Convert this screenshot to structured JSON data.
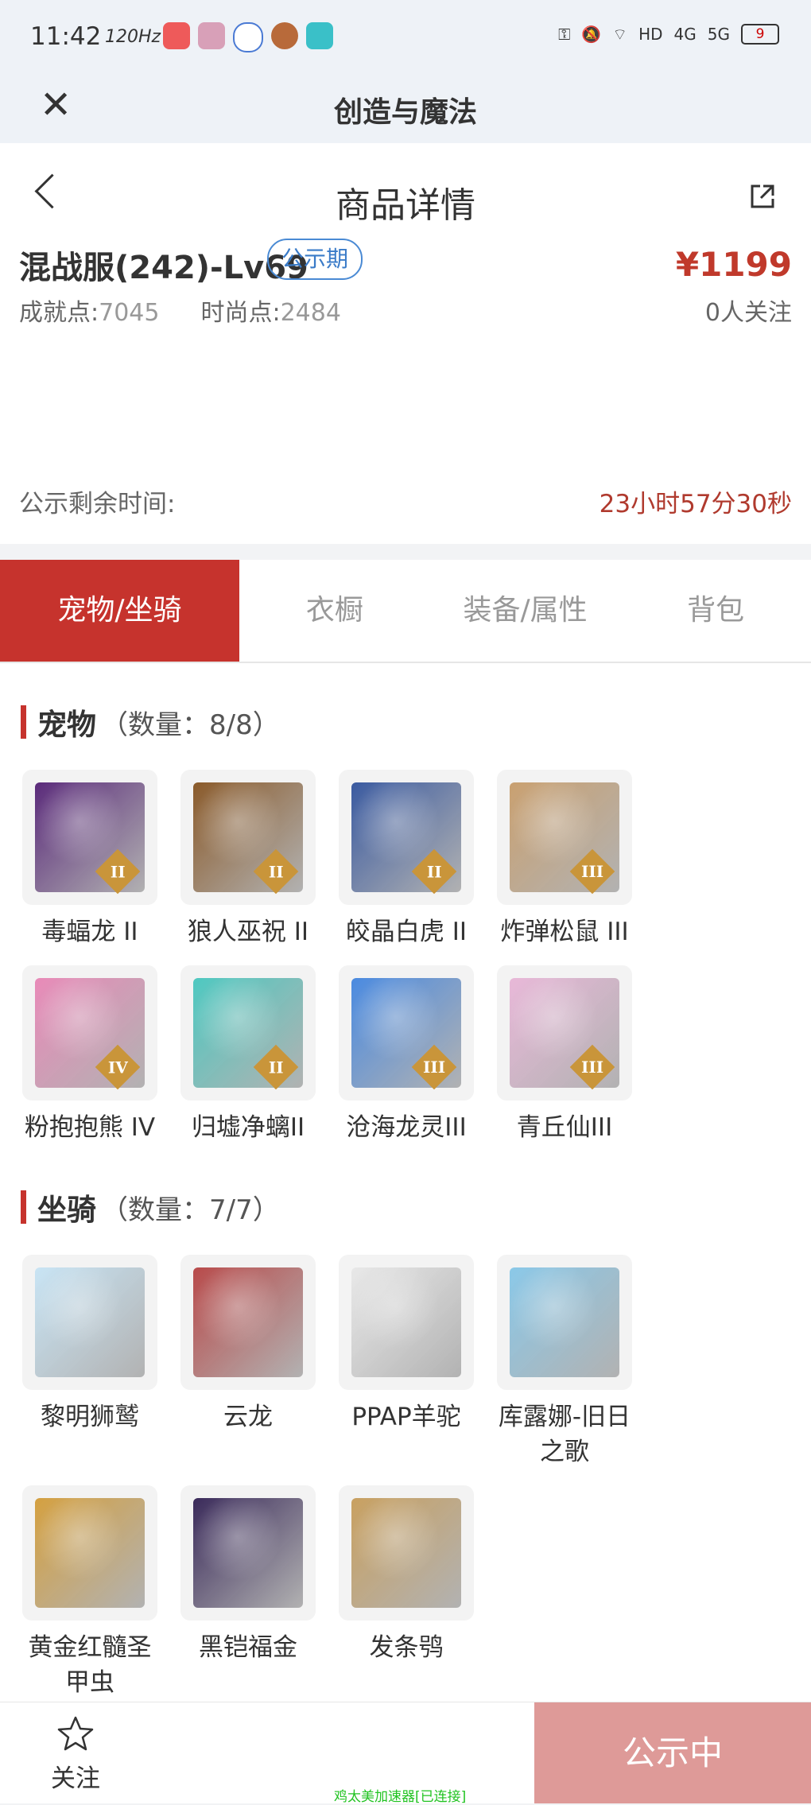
{
  "status_bar": {
    "time": "11:42",
    "refresh": "120Hz",
    "signal_4g": "4G",
    "signal_5g": "5G",
    "hd": "HD",
    "battery": "9"
  },
  "app_bar": {
    "title": "创造与魔法"
  },
  "header": {
    "title": "商品详情"
  },
  "product": {
    "name": "混战服(242)-Lv69",
    "badge": "公示期",
    "price": "¥1199",
    "achievement_label": "成就点:",
    "achievement_value": "7045",
    "fashion_label": "时尚点:",
    "fashion_value": "2484",
    "followers": "0人关注"
  },
  "countdown": {
    "label": "公示剩余时间:",
    "value": "23小时57分30秒"
  },
  "tabs": [
    {
      "label": "宠物/坐骑"
    },
    {
      "label": "衣橱"
    },
    {
      "label": "装备/属性"
    },
    {
      "label": "背包"
    }
  ],
  "pets": {
    "title": "宠物",
    "count": "（数量：8/8）",
    "items": [
      {
        "name": "毒蝠龙 II",
        "tier": "II",
        "color": "#5a2a7a"
      },
      {
        "name": "狼人巫祝 II",
        "tier": "II",
        "color": "#8a5a2a"
      },
      {
        "name": "皎晶白虎 II",
        "tier": "II",
        "color": "#3a5aa0"
      },
      {
        "name": "炸弹松鼠 III",
        "tier": "III",
        "color": "#c9a070"
      },
      {
        "name": "粉抱抱熊 IV",
        "tier": "IV",
        "color": "#e88ab8"
      },
      {
        "name": "归墟净螭II",
        "tier": "II",
        "color": "#4ec8c0"
      },
      {
        "name": "沧海龙灵III",
        "tier": "III",
        "color": "#4a8ae0"
      },
      {
        "name": "青丘仙III",
        "tier": "III",
        "color": "#e8b8d8"
      }
    ]
  },
  "mounts": {
    "title": "坐骑",
    "count": "（数量：7/7）",
    "items": [
      {
        "name": "黎明狮鹫",
        "color": "#c8e4f4"
      },
      {
        "name": "云龙",
        "color": "#b84a4a"
      },
      {
        "name": "PPAP羊驼",
        "color": "#e8e8e8"
      },
      {
        "name": "库露娜-旧日之歌",
        "color": "#8ac8e8"
      },
      {
        "name": "黄金红髓圣甲虫",
        "color": "#d4a040"
      },
      {
        "name": "黑铠福金",
        "color": "#3a2a5a"
      },
      {
        "name": "发条鸮",
        "color": "#c8a060"
      }
    ]
  },
  "bottom_bar": {
    "follow_label": "关注",
    "watermark": "鸡太美加速器[已连接]",
    "status_button": "公示中"
  }
}
